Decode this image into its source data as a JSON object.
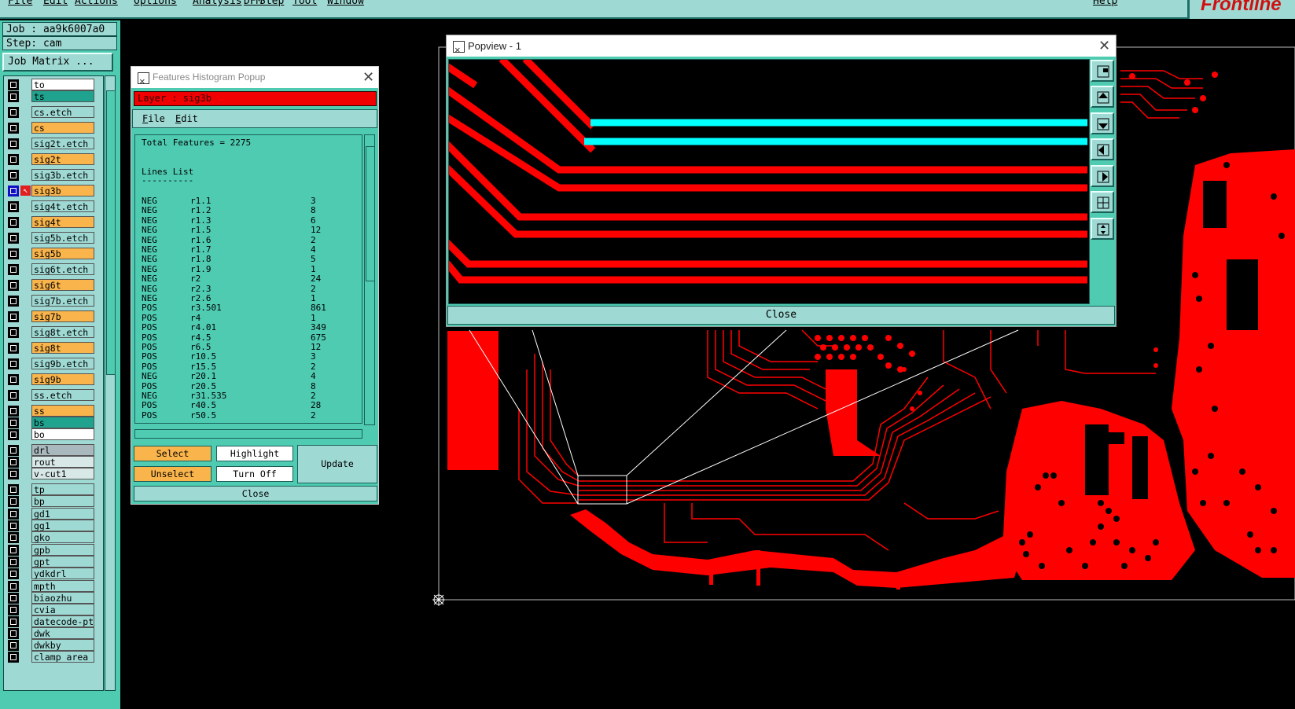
{
  "menubar": {
    "items": [
      "File",
      "Edit",
      "Actions",
      "Options",
      "Analysis",
      "DFM",
      "Step",
      "Tool",
      "Window"
    ],
    "help": "Help",
    "logo": "Frontline"
  },
  "left_panel": {
    "job": "Job : aa9k6007a0",
    "step": "Step: cam",
    "job_matrix": "Job Matrix ...",
    "layers": [
      {
        "name": "to",
        "color": "#ffffff"
      },
      {
        "name": "ts",
        "color": "#1fa38f"
      },
      {
        "name": "cs.etch",
        "color": "#9fd9d3"
      },
      {
        "name": "cs",
        "color": "#f9b44c"
      },
      {
        "name": "sig2t.etch",
        "color": "#9fd9d3"
      },
      {
        "name": "sig2t",
        "color": "#f9b44c"
      },
      {
        "name": "sig3b.etch",
        "color": "#9fd9d3"
      },
      {
        "name": "sig3b",
        "color": "#f9b44c",
        "active": true
      },
      {
        "name": "sig4t.etch",
        "color": "#9fd9d3"
      },
      {
        "name": "sig4t",
        "color": "#f9b44c"
      },
      {
        "name": "sig5b.etch",
        "color": "#9fd9d3"
      },
      {
        "name": "sig5b",
        "color": "#f9b44c"
      },
      {
        "name": "sig6t.etch",
        "color": "#9fd9d3"
      },
      {
        "name": "sig6t",
        "color": "#f9b44c"
      },
      {
        "name": "sig7b.etch",
        "color": "#9fd9d3"
      },
      {
        "name": "sig7b",
        "color": "#f9b44c"
      },
      {
        "name": "sig8t.etch",
        "color": "#9fd9d3"
      },
      {
        "name": "sig8t",
        "color": "#f9b44c"
      },
      {
        "name": "sig9b.etch",
        "color": "#9fd9d3"
      },
      {
        "name": "sig9b",
        "color": "#f9b44c"
      },
      {
        "name": "ss.etch",
        "color": "#9fd9d3"
      },
      {
        "name": "ss",
        "color": "#f9b44c"
      },
      {
        "name": "bs",
        "color": "#1fa38f"
      },
      {
        "name": "bo",
        "color": "#ffffff"
      },
      {
        "name": "drl",
        "color": "#a9b8bc"
      },
      {
        "name": "rout",
        "color": "#d8e8e6"
      },
      {
        "name": "v-cut1",
        "color": "#d8e8e6"
      },
      {
        "name": "tp",
        "color": "#9fd9d3"
      },
      {
        "name": "bp",
        "color": "#9fd9d3"
      },
      {
        "name": "gd1",
        "color": "#9fd9d3"
      },
      {
        "name": "gg1",
        "color": "#9fd9d3"
      },
      {
        "name": "gko",
        "color": "#9fd9d3"
      },
      {
        "name": "gpb",
        "color": "#9fd9d3"
      },
      {
        "name": "gpt",
        "color": "#9fd9d3"
      },
      {
        "name": "ydkdrl",
        "color": "#9fd9d3"
      },
      {
        "name": "mpth",
        "color": "#9fd9d3"
      },
      {
        "name": "biaozhu",
        "color": "#9fd9d3"
      },
      {
        "name": "cvia",
        "color": "#9fd9d3"
      },
      {
        "name": "datecode-ptc",
        "color": "#9fd9d3"
      },
      {
        "name": "dwk",
        "color": "#9fd9d3"
      },
      {
        "name": "dwkby",
        "color": "#9fd9d3"
      },
      {
        "name": "clamp_area",
        "color": "#9fd9d3"
      }
    ]
  },
  "histogram": {
    "title": "Features Histogram Popup",
    "layer_label": "Layer :  sig3b",
    "menu": [
      "File",
      "Edit"
    ],
    "total": "Total Features = 2275",
    "list_title": "Lines List",
    "underline": "----------",
    "rows": [
      [
        "NEG",
        "r1.1",
        "3"
      ],
      [
        "NEG",
        "r1.2",
        "8"
      ],
      [
        "NEG",
        "r1.3",
        "6"
      ],
      [
        "NEG",
        "r1.5",
        "12"
      ],
      [
        "NEG",
        "r1.6",
        "2"
      ],
      [
        "NEG",
        "r1.7",
        "4"
      ],
      [
        "NEG",
        "r1.8",
        "5"
      ],
      [
        "NEG",
        "r1.9",
        "1"
      ],
      [
        "NEG",
        "r2",
        "24"
      ],
      [
        "NEG",
        "r2.3",
        "2"
      ],
      [
        "NEG",
        "r2.6",
        "1"
      ],
      [
        "POS",
        "r3.501",
        "861"
      ],
      [
        "POS",
        "r4",
        "1"
      ],
      [
        "POS",
        "r4.01",
        "349"
      ],
      [
        "POS",
        "r4.5",
        "675"
      ],
      [
        "POS",
        "r6.5",
        "12"
      ],
      [
        "POS",
        "r10.5",
        "3"
      ],
      [
        "POS",
        "r15.5",
        "2"
      ],
      [
        "NEG",
        "r20.1",
        "4"
      ],
      [
        "POS",
        "r20.5",
        "8"
      ],
      [
        "NEG",
        "r31.535",
        "2"
      ],
      [
        "POS",
        "r40.5",
        "28"
      ],
      [
        "POS",
        "r50.5",
        "2"
      ]
    ],
    "buttons": {
      "select": "Select",
      "highlight": "Highlight",
      "update": "Update",
      "unselect": "Unselect",
      "turn_off": "Turn Off",
      "close": "Close"
    }
  },
  "popview": {
    "title": "Popview - 1",
    "close": "Close"
  },
  "colors": {
    "panel_teal": "#4fcbb2",
    "light_teal": "#9fd9d3",
    "trace_red": "#ff0000",
    "highlight_cyan": "#00ffff",
    "button_orange": "#f9b44c"
  }
}
